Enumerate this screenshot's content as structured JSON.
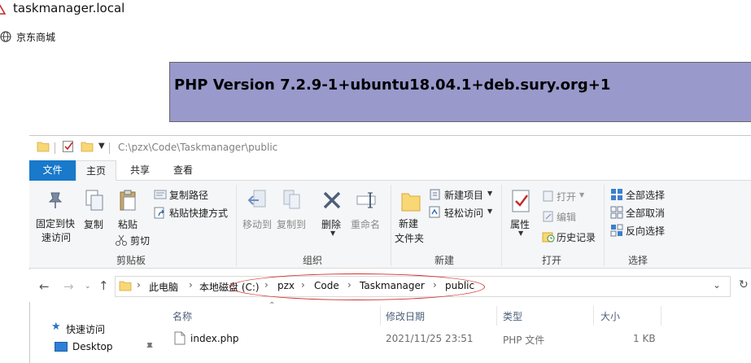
{
  "browser": {
    "url": "taskmanager.local",
    "bookmark": "京东商城"
  },
  "php": {
    "title": "PHP Version 7.2.9-1+ubuntu18.04.1+deb.sury.org+1"
  },
  "explorer": {
    "path": "C:\\pzx\\Code\\Taskmanager\\public",
    "tabs": [
      "文件",
      "主页",
      "共享",
      "查看"
    ],
    "ribbon": {
      "clipboard": {
        "label": "剪贴板",
        "pin_line1": "固定到快",
        "pin_line2": "速访问",
        "copy": "复制",
        "paste": "粘贴",
        "copy_path": "复制路径",
        "paste_shortcut": "粘贴快捷方式",
        "cut": "剪切"
      },
      "organize": {
        "label": "组织",
        "move_to": "移动到",
        "copy_to": "复制到",
        "delete": "删除",
        "rename": "重命名"
      },
      "new": {
        "label": "新建",
        "new_folder_line1": "新建",
        "new_folder_line2": "文件夹",
        "new_item": "新建项目",
        "easy_access": "轻松访问"
      },
      "open": {
        "label": "打开",
        "properties": "属性",
        "open": "打开",
        "edit": "编辑",
        "history": "历史记录"
      },
      "select": {
        "label": "选择",
        "select_all": "全部选择",
        "select_none": "全部取消",
        "invert": "反向选择"
      }
    },
    "breadcrumb": [
      "此电脑",
      "本地磁盘 (C:)",
      "pzx",
      "Code",
      "Taskmanager",
      "public"
    ],
    "sidebar": {
      "quick_access": "快速访问",
      "desktop": "Desktop"
    },
    "columns": [
      "名称",
      "修改日期",
      "类型",
      "大小"
    ],
    "files": [
      {
        "name": "index.php",
        "modified": "2021/11/25 23:51",
        "type": "PHP 文件",
        "size": "1 KB"
      }
    ],
    "colors": {
      "file_tab": "#1979ca",
      "ribbon_bg": "#f5f6f7",
      "php_banner": "#9999cc",
      "annotation_oval": "#d32f2f"
    }
  }
}
